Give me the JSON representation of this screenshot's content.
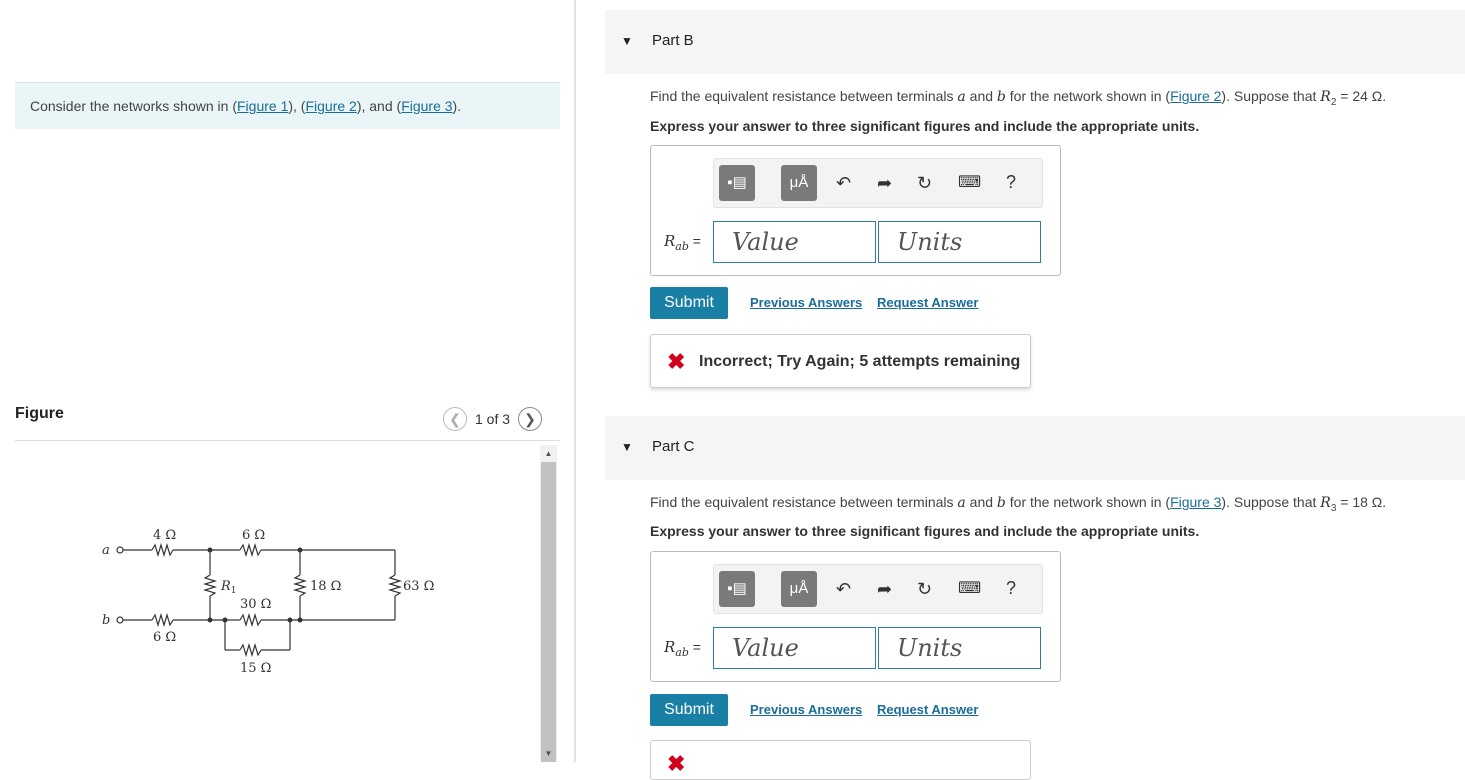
{
  "intro": {
    "prefix": "Consider the networks shown in (",
    "figure1": "Figure 1",
    "sep1": "), (",
    "figure2": "Figure 2",
    "sep2": "), and (",
    "figure3": "Figure 3",
    "suffix": ")."
  },
  "figure_panel": {
    "title": "Figure",
    "counter": "1 of 3",
    "prev_icon": "chevron-left-icon",
    "next_icon": "chevron-right-icon",
    "circuit": {
      "terminal_a": "a",
      "terminal_b": "b",
      "r_top_left": "4 Ω",
      "r_top_mid": "6 Ω",
      "r_bottom_left": "6 Ω",
      "r1": "R",
      "r1_sub": "1",
      "r_30": "30 Ω",
      "r_15": "15 Ω",
      "r_18": "18 Ω",
      "r_63": "63 Ω"
    }
  },
  "partB": {
    "label": "Part B",
    "question_pre": "Find the equivalent resistance between terminals ",
    "term_a": "a",
    "and": " and ",
    "term_b": "b",
    "question_mid": " for the network shown in (",
    "figure_link": "Figure 2",
    "question_post": "). Suppose that ",
    "var": "R",
    "var_sub": "2",
    "value": " = 24 Ω.",
    "instruction": "Express your answer to three significant figures and include the appropriate units.",
    "answer_label": "R",
    "answer_label_sub": "ab",
    "answer_eq": " =",
    "value_placeholder": "Value",
    "units_placeholder": "Units",
    "submit": "Submit",
    "previous_answers": "Previous Answers",
    "request_answer": "Request Answer",
    "feedback": "Incorrect; Try Again; 5 attempts remaining"
  },
  "partC": {
    "label": "Part C",
    "question_pre": "Find the equivalent resistance between terminals ",
    "term_a": "a",
    "and": " and ",
    "term_b": "b",
    "question_mid": " for the network shown in (",
    "figure_link": "Figure 3",
    "question_post": "). Suppose that ",
    "var": "R",
    "var_sub": "3",
    "value": " = 18 Ω.",
    "instruction": "Express your answer to three significant figures and include the appropriate units.",
    "answer_label": "R",
    "answer_label_sub": "ab",
    "answer_eq": " =",
    "value_placeholder": "Value",
    "units_placeholder": "Units",
    "submit": "Submit",
    "previous_answers": "Previous Answers",
    "request_answer": "Request Answer"
  },
  "toolbar": {
    "unit_button": "μÅ",
    "help": "?"
  }
}
